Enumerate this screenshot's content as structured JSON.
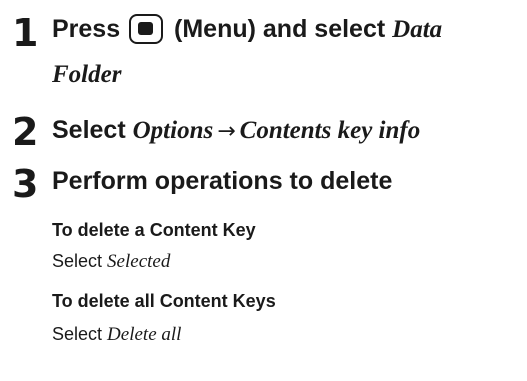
{
  "steps": [
    {
      "number": "1",
      "line1_prefix": "Press",
      "menu_key_icon": "menu-key-icon",
      "line1_mid": "(Menu) and select",
      "line1_italic": "Data",
      "line2_italic": "Folder"
    },
    {
      "number": "2",
      "prefix": "Select",
      "italic_a": "Options",
      "arrow": "→",
      "italic_b": "Contents key info"
    },
    {
      "number": "3",
      "text": "Perform operations to delete",
      "subsections": [
        {
          "heading": "To delete a Content Key",
          "body_prefix": "Select",
          "body_italic": "Selected"
        },
        {
          "heading": "To delete all Content Keys",
          "body_prefix": "Select",
          "body_italic": "Delete all"
        }
      ]
    }
  ]
}
